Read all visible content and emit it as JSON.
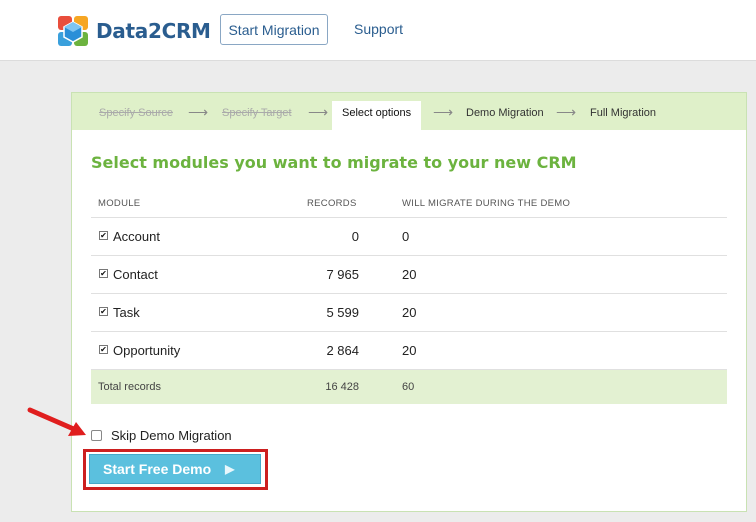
{
  "header": {
    "logo_text": "Data2CRM",
    "start_migration_label": "Start Migration",
    "support_label": "Support"
  },
  "steps": [
    {
      "label": "Specify Source",
      "state": "done"
    },
    {
      "label": "Specify Target",
      "state": "done"
    },
    {
      "label": "Select options",
      "state": "active"
    },
    {
      "label": "Demo Migration",
      "state": "pending"
    },
    {
      "label": "Full Migration",
      "state": "pending"
    }
  ],
  "step_separator": "⟶",
  "heading": "Select modules you want to migrate to your new CRM",
  "table": {
    "columns": [
      "MODULE",
      "RECORDS",
      "WILL MIGRATE DURING THE DEMO"
    ],
    "rows": [
      {
        "module": "Account",
        "records": "0",
        "demo": "0",
        "checked": true
      },
      {
        "module": "Contact",
        "records": "7 965",
        "demo": "20",
        "checked": true
      },
      {
        "module": "Task",
        "records": "5 599",
        "demo": "20",
        "checked": true
      },
      {
        "module": "Opportunity",
        "records": "2 864",
        "demo": "20",
        "checked": true
      }
    ],
    "total": {
      "label": "Total records",
      "records": "16 428",
      "demo": "60"
    }
  },
  "skip_demo_label": "Skip Demo Migration",
  "start_demo_label": "Start Free Demo",
  "check_glyph": "✔",
  "colors": {
    "brand_blue": "#2a5d8f",
    "heading_green": "#6cb33f",
    "step_bar": "#dff0c9",
    "demo_button": "#5bc0de",
    "highlight_red": "#cc1f1f"
  }
}
